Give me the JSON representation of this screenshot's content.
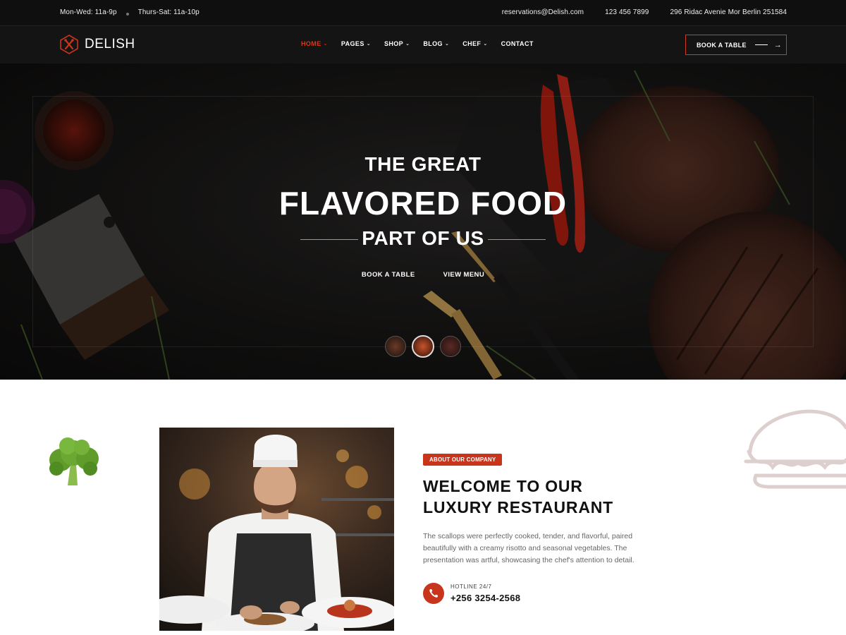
{
  "topbar": {
    "hours_weekday": "Mon-Wed: 11a-9p",
    "hours_weekend": "Thurs-Sat: 11a-10p",
    "email": "reservations@Delish.com",
    "phone": "123 456 7899",
    "address": "296 Ridac Avenie Mor Berlin 251584"
  },
  "nav": {
    "brand": "DELISH",
    "items": [
      {
        "label": "HOME",
        "active": true
      },
      {
        "label": "PAGES",
        "active": false
      },
      {
        "label": "SHOP",
        "active": false
      },
      {
        "label": "BLOG",
        "active": false
      },
      {
        "label": "CHEF",
        "active": false
      },
      {
        "label": "CONTACT",
        "active": false
      }
    ],
    "book_label": "BOOK A TABLE"
  },
  "hero": {
    "line1": "THE GREAT",
    "line2": "FLAVORED FOOD",
    "line3": "PART OF US",
    "link_book": "BOOK A TABLE",
    "link_menu": "VIEW MENU",
    "slide_active": 2,
    "slide_count": 3
  },
  "about": {
    "badge": "ABOUT OUR COMPANY",
    "title_line1": "WELCOME TO OUR",
    "title_line2": "LUXURY RESTAURANT",
    "text": "The scallops were perfectly cooked, tender, and flavorful, paired beautifully with a creamy risotto and seasonal vegetables. The presentation was artful, showcasing the chef's attention to detail.",
    "hotline_label": "HOTLINE 24/7",
    "hotline_number": "+256 3254-2568"
  },
  "colors": {
    "accent": "#c8341c",
    "dark": "#141414"
  }
}
